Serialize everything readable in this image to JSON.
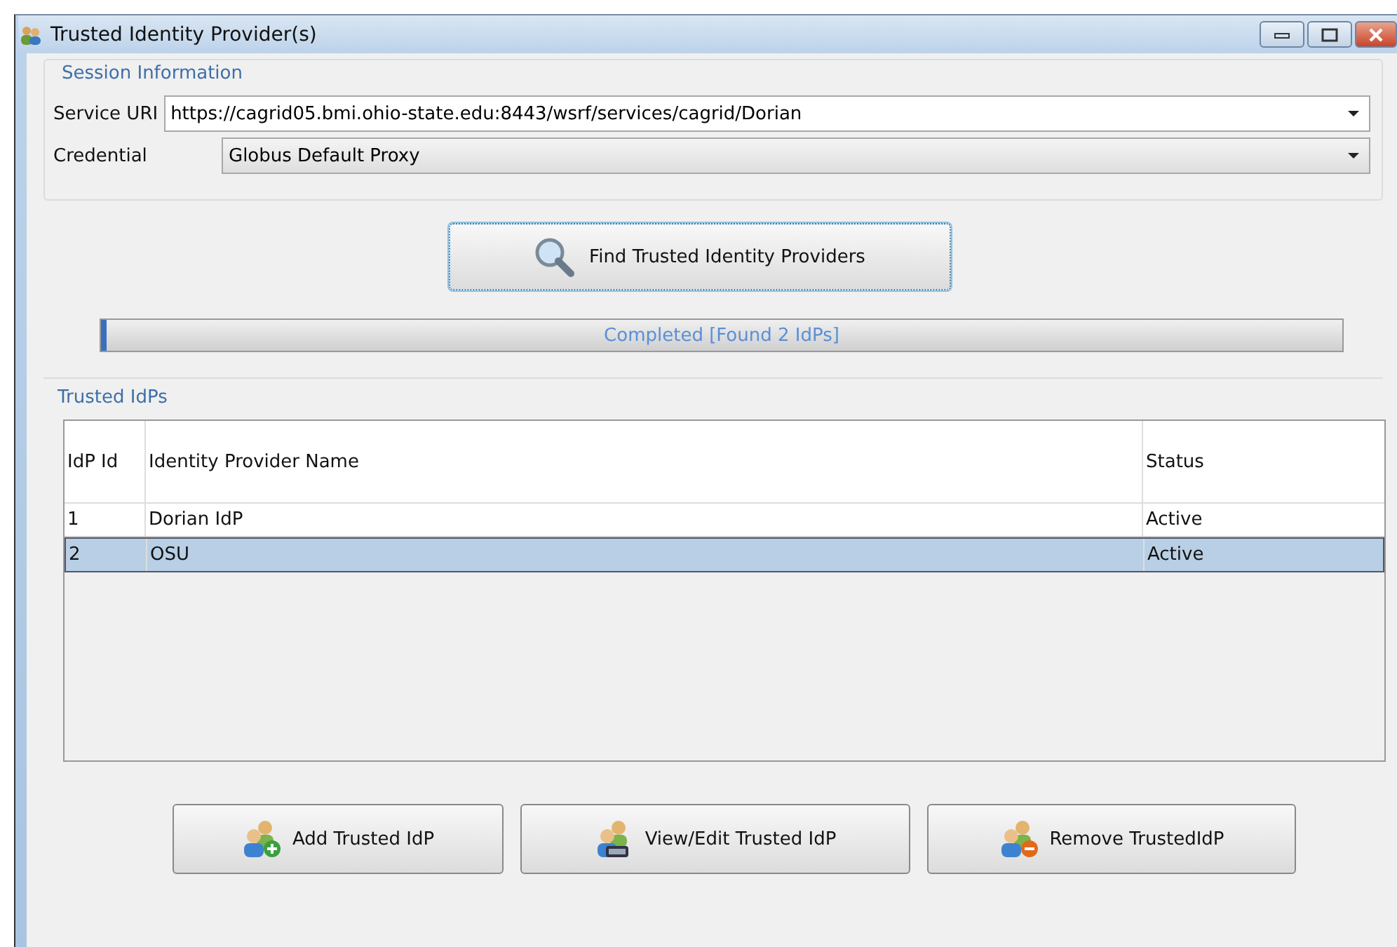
{
  "window": {
    "title": "Trusted Identity Provider(s)"
  },
  "session": {
    "title": "Session Information",
    "service_uri_label": "Service URI",
    "service_uri": "https://cagrid05.bmi.ohio-state.edu:8443/wsrf/services/cagrid/Dorian",
    "credential_label": "Credential",
    "credential": "Globus Default Proxy"
  },
  "find_button": "Find Trusted Identity Providers",
  "progress": {
    "text": "Completed [Found 2 IdPs]",
    "level": 0.004
  },
  "trusted": {
    "title": "Trusted IdPs",
    "columns": [
      "IdP Id",
      "Identity Provider Name",
      "Status"
    ],
    "rows": [
      {
        "cells": [
          "1",
          "Dorian IdP",
          "Active"
        ],
        "selected": false
      },
      {
        "cells": [
          "2",
          "OSU",
          "Active"
        ],
        "selected": true
      }
    ]
  },
  "buttons": [
    {
      "label": "Add Trusted IdP",
      "kind": "add"
    },
    {
      "label": "View/Edit Trusted IdP",
      "kind": "edit"
    },
    {
      "label": "Remove TrustedIdP",
      "kind": "remove"
    }
  ]
}
